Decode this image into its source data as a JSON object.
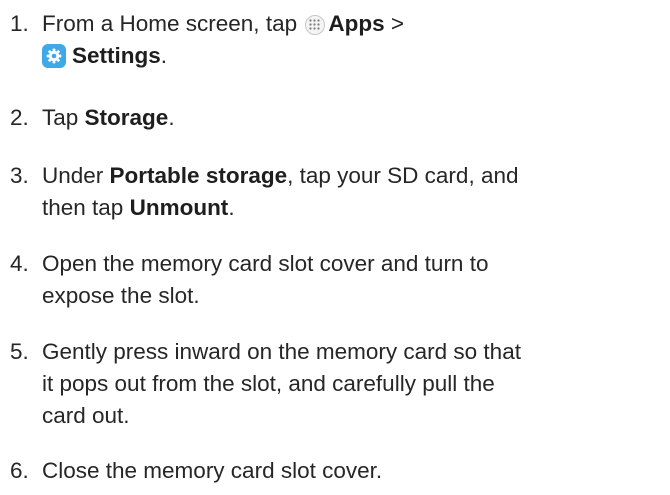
{
  "steps": [
    {
      "number": "1.",
      "pre": "From a Home screen, tap ",
      "icon1": "apps-icon",
      "apps_label": "Apps",
      "sep": " >",
      "icon2": "settings-icon",
      "settings_label": "Settings",
      "end": "."
    },
    {
      "number": "2.",
      "pre": "Tap ",
      "bold": "Storage",
      "end": "."
    },
    {
      "number": "3.",
      "pre": "Under ",
      "bold1": "Portable storage",
      "mid": ", tap your SD card, and",
      "line2_pre": "then tap ",
      "bold2": "Unmount",
      "end": "."
    },
    {
      "number": "4.",
      "line1": "Open the memory card slot cover and turn to",
      "line2": "expose the slot."
    },
    {
      "number": "5.",
      "line1": "Gently press inward on the memory card so that",
      "line2": "it pops out from the slot, and carefully pull the",
      "line3": "card out."
    },
    {
      "number": "6.",
      "line1": "Close the memory card slot cover."
    }
  ],
  "colors": {
    "text": "#262626",
    "settings_icon_bg": "#3fa8e6"
  }
}
